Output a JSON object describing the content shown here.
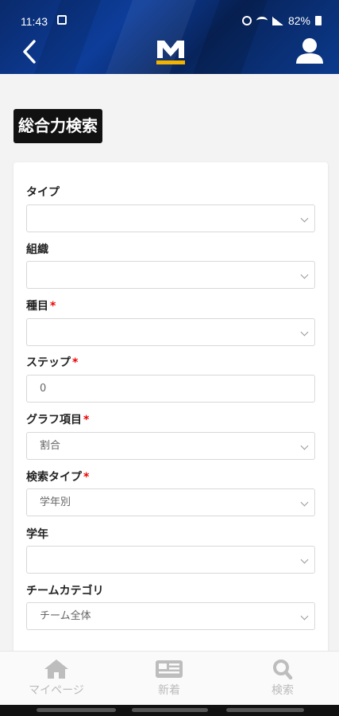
{
  "status_bar": {
    "time": "11:43",
    "battery": "82%"
  },
  "page": {
    "title": "総合力検索"
  },
  "form": {
    "fields": [
      {
        "label": "タイプ",
        "required": false,
        "type": "select",
        "value": ""
      },
      {
        "label": "組織",
        "required": false,
        "type": "select",
        "value": ""
      },
      {
        "label": "種目",
        "required": true,
        "type": "select",
        "value": ""
      },
      {
        "label": "ステップ",
        "required": true,
        "type": "input",
        "value": "0"
      },
      {
        "label": "グラフ項目",
        "required": true,
        "type": "select",
        "value": "割合"
      },
      {
        "label": "検索タイプ",
        "required": true,
        "type": "select",
        "value": "学年別"
      },
      {
        "label": "学年",
        "required": false,
        "type": "select",
        "value": ""
      },
      {
        "label": "チームカテゴリ",
        "required": false,
        "type": "select",
        "value": "チーム全体"
      }
    ],
    "required_mark": "*"
  },
  "bottom_nav": {
    "items": [
      {
        "label": "マイページ",
        "icon": "home-icon"
      },
      {
        "label": "新着",
        "icon": "news-icon"
      },
      {
        "label": "検索",
        "icon": "search-icon"
      }
    ]
  },
  "colors": {
    "header": "#0d3d9a",
    "required": "#e00000",
    "title_bg": "#111111"
  }
}
